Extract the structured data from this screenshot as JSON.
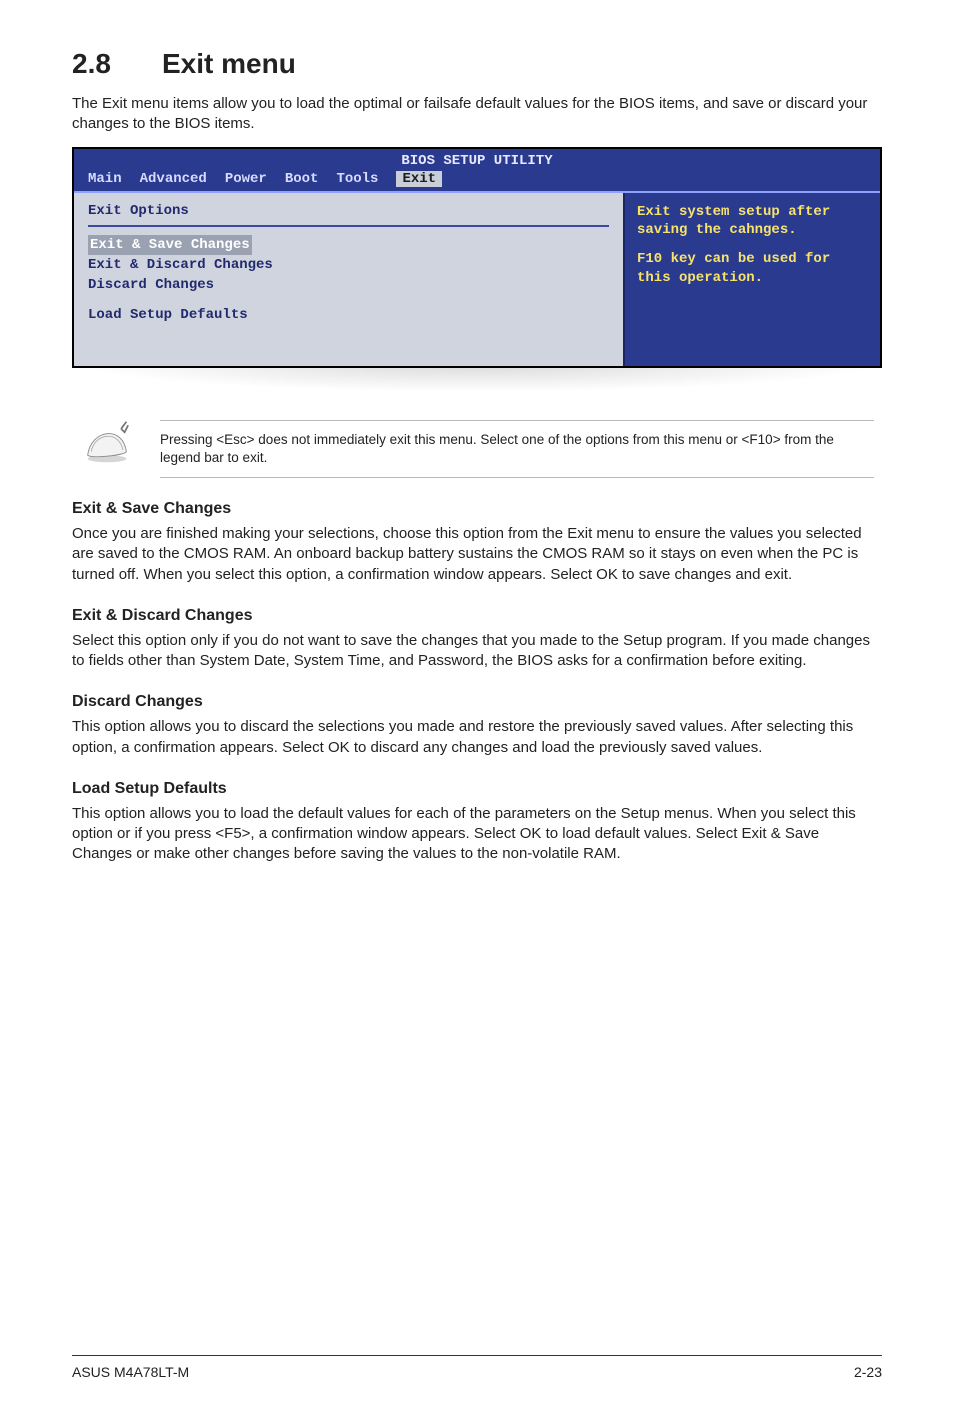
{
  "heading": {
    "num": "2.8",
    "title": "Exit menu"
  },
  "intro": "The Exit menu items allow you to load the optimal or failsafe default values for the BIOS items, and save or discard your changes to the BIOS items.",
  "bios": {
    "title": "BIOS SETUP UTILITY",
    "tabs": [
      "Main",
      "Advanced",
      "Power",
      "Boot",
      "Tools",
      "Exit"
    ],
    "left_header": "Exit Options",
    "items": [
      "Exit & Save Changes",
      "Exit & Discard Changes",
      "Discard Changes",
      "Load Setup Defaults"
    ],
    "right_lines": [
      "Exit system setup after saving the cahnges.",
      "F10 key can be used for this operation."
    ]
  },
  "note": "Pressing <Esc> does not immediately exit this menu. Select one of the options from this menu or <F10> from the legend bar to exit.",
  "sections": [
    {
      "h": "Exit & Save Changes",
      "p": "Once you are finished making your selections, choose this option from the Exit menu to ensure the values you selected are saved to the CMOS RAM. An onboard backup battery sustains the CMOS RAM so it stays on even when the PC is turned off. When you select this option, a confirmation window appears. Select OK to save changes and exit."
    },
    {
      "h": "Exit & Discard Changes",
      "p": "Select this option only if you do not want to save the changes that you made to the Setup program. If you made changes to fields other than System Date, System Time, and Password, the BIOS asks for a confirmation before exiting."
    },
    {
      "h": "Discard Changes",
      "p": "This option allows you to discard the selections you made and restore the previously saved values. After selecting this option, a confirmation appears. Select OK to discard any changes and load the previously saved values."
    },
    {
      "h": "Load Setup Defaults",
      "p": "This option allows you to load the default values for each of the parameters on the Setup menus. When you select this option or if you press <F5>, a confirmation window appears. Select OK to load default values. Select Exit & Save Changes or make other changes before saving the values to the non-volatile RAM."
    }
  ],
  "footer": {
    "left": "ASUS M4A78LT-M",
    "right": "2-23"
  }
}
